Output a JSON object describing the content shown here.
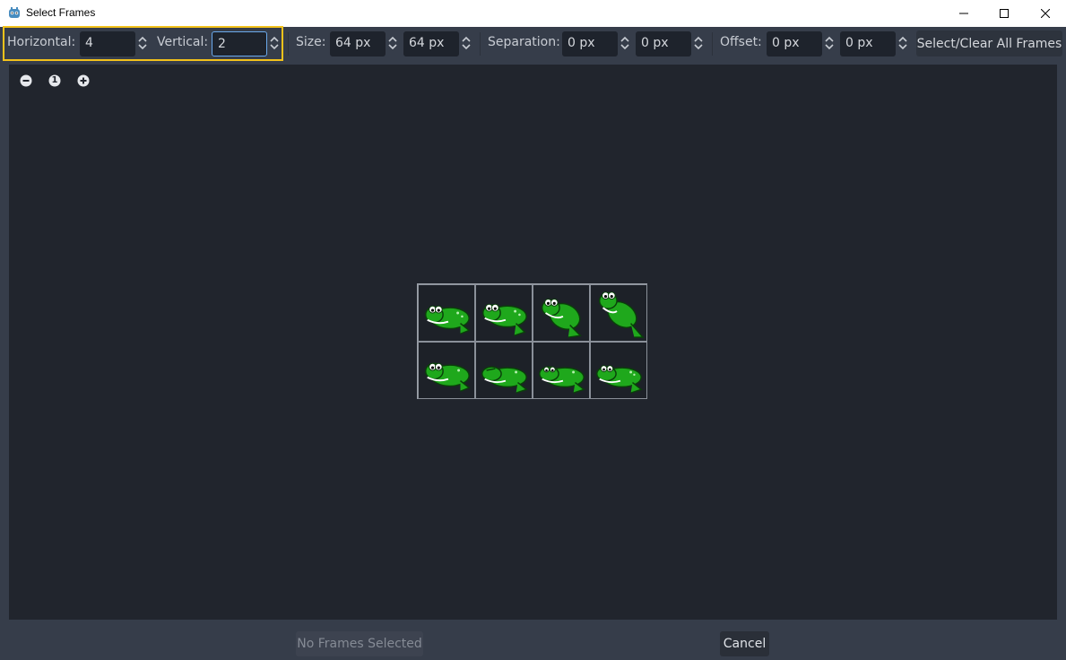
{
  "window": {
    "title": "Select Frames",
    "icon": "godot-icon",
    "controls": [
      "minimize-icon",
      "maximize-icon",
      "close-icon"
    ]
  },
  "toolbar": {
    "horizontal_label": "Horizontal:",
    "horizontal_value": "4",
    "vertical_label": "Vertical:",
    "vertical_value": "2",
    "size_label": "Size:",
    "size_x": "64 px",
    "size_y": "64 px",
    "separation_label": "Separation:",
    "separation_x": "0 px",
    "separation_y": "0 px",
    "offset_label": "Offset:",
    "offset_x": "0 px",
    "offset_y": "0 px",
    "select_all_label": "Select/Clear All Frames"
  },
  "zoom": {
    "zoom_out": "zoom-out-icon",
    "zoom_reset": "1",
    "zoom_in": "zoom-in-icon"
  },
  "sheet": {
    "columns": 4,
    "rows": 2,
    "frames": [
      "frog-frame",
      "frog-frame",
      "frog-frame",
      "frog-frame",
      "frog-frame",
      "frog-frame",
      "frog-frame",
      "frog-frame"
    ]
  },
  "footer": {
    "confirm_label": "No Frames Selected",
    "cancel_label": "Cancel"
  },
  "colors": {
    "accent_highlight": "#f3c21b",
    "focus_border": "#6aa9ec",
    "frog_green": "#1fa81c"
  }
}
